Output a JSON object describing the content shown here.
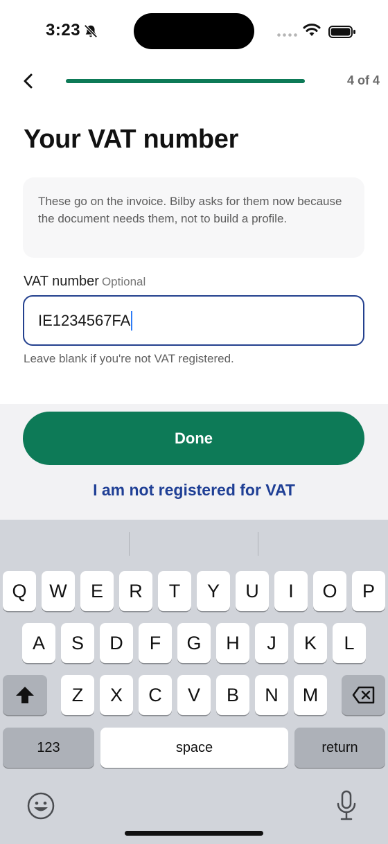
{
  "status_bar": {
    "time": "3:23"
  },
  "header": {
    "step_text": "4 of 4",
    "progress": 1.0
  },
  "page": {
    "title": "Your VAT number",
    "info_text": "These go on the invoice. Bilby asks for them now because the document needs them, not to build a profile."
  },
  "vat_field": {
    "label": "VAT number",
    "optional_tag": "Optional",
    "value": "IE1234567FA",
    "hint": "Leave blank if you're not VAT registered."
  },
  "actions": {
    "done_label": "Done",
    "not_registered_label": "I am not registered for VAT"
  },
  "keyboard": {
    "row1": [
      "Q",
      "W",
      "E",
      "R",
      "T",
      "Y",
      "U",
      "I",
      "O",
      "P"
    ],
    "row2": [
      "A",
      "S",
      "D",
      "F",
      "G",
      "H",
      "J",
      "K",
      "L"
    ],
    "row3": [
      "Z",
      "X",
      "C",
      "V",
      "B",
      "N",
      "M"
    ],
    "numbers_label": "123",
    "space_label": "space",
    "return_label": "return"
  },
  "icons": {
    "back": "chevron-left-icon",
    "mute": "bell-slash-icon",
    "wifi": "wifi-icon",
    "battery": "battery-icon",
    "shift": "shift-icon",
    "delete": "backspace-icon",
    "emoji": "emoji-icon",
    "mic": "microphone-icon"
  },
  "colors": {
    "accent": "#0d7a57",
    "link": "#1f3f95",
    "focus_border": "#23408e"
  }
}
